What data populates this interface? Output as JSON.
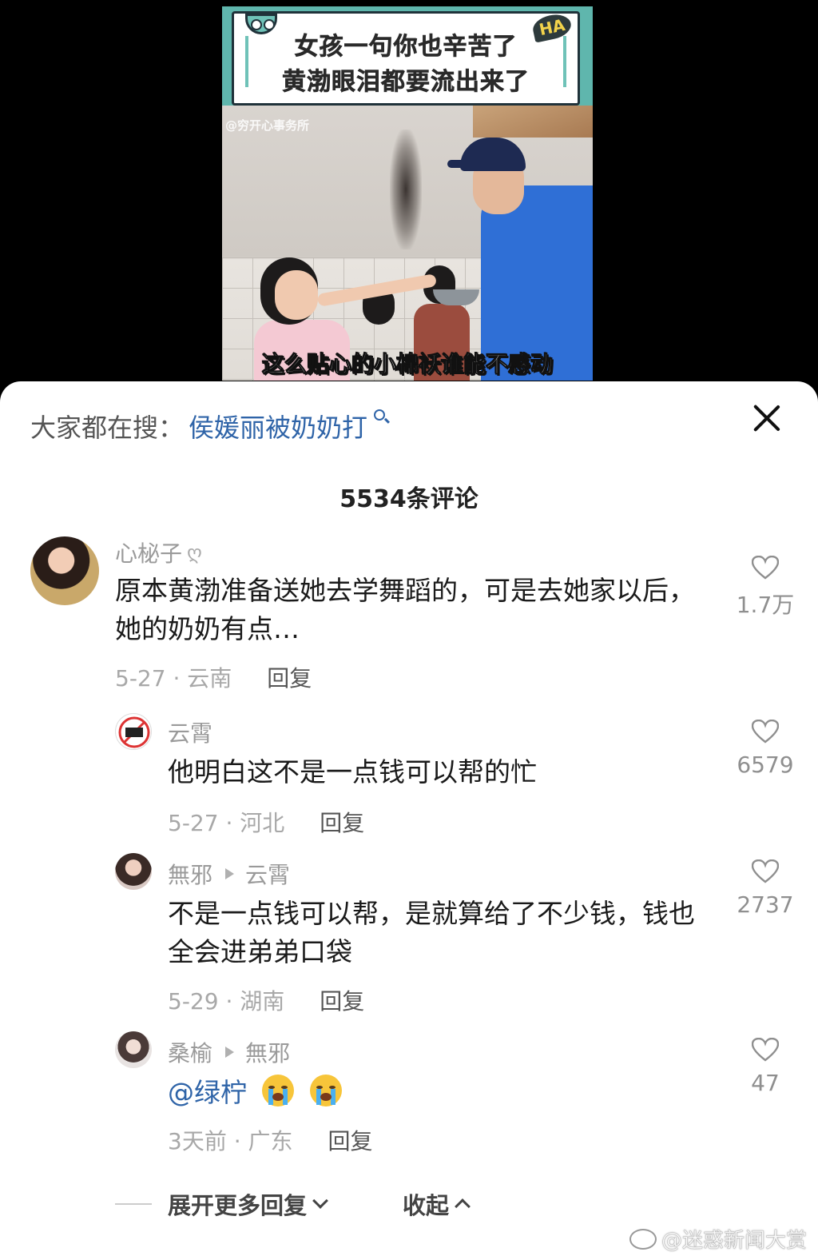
{
  "video": {
    "title_line1": "女孩一句你也辛苦了",
    "title_line2": "黄渤眼泪都要流出来了",
    "badge": "HA",
    "watermark": "@穷开心事务所",
    "subtitle": "这么贴心的小棉袄谁能不感动"
  },
  "search": {
    "label": "大家都在搜：",
    "term": "侯媛丽被奶奶打"
  },
  "comment_count": "5534条评论",
  "comments": [
    {
      "user": "心柲子",
      "user_tag": "ღ",
      "text": "原本黄渤准备送她去学舞蹈的，可是去她家以后，她的奶奶有点…",
      "date": "5-27 · 云南",
      "reply_label": "回复",
      "likes": "1.7万"
    },
    {
      "user": "云霄",
      "text": "他明白这不是一点钱可以帮的忙",
      "date": "5-27 · 河北",
      "reply_label": "回复",
      "likes": "6579"
    },
    {
      "user": "無邪",
      "reply_to": "云霄",
      "text": "不是一点钱可以帮，是就算给了不少钱，钱也全会进弟弟口袋",
      "date": "5-29 · 湖南",
      "reply_label": "回复",
      "likes": "2737"
    },
    {
      "user": "桑榆",
      "reply_to": "無邪",
      "mention": "@绿柠",
      "emojis": [
        "crying-face-icon",
        "crying-face-icon"
      ],
      "date": "3天前 · 广东",
      "reply_label": "回复",
      "likes": "47"
    }
  ],
  "expand_label": "展开更多回复",
  "collapse_label": "收起",
  "footer_watermark": "@迷惑新闻大赏",
  "colors": {
    "link": "#2f64a8",
    "muted": "#9a9a9a",
    "video_bg": "#5fb6ad"
  }
}
